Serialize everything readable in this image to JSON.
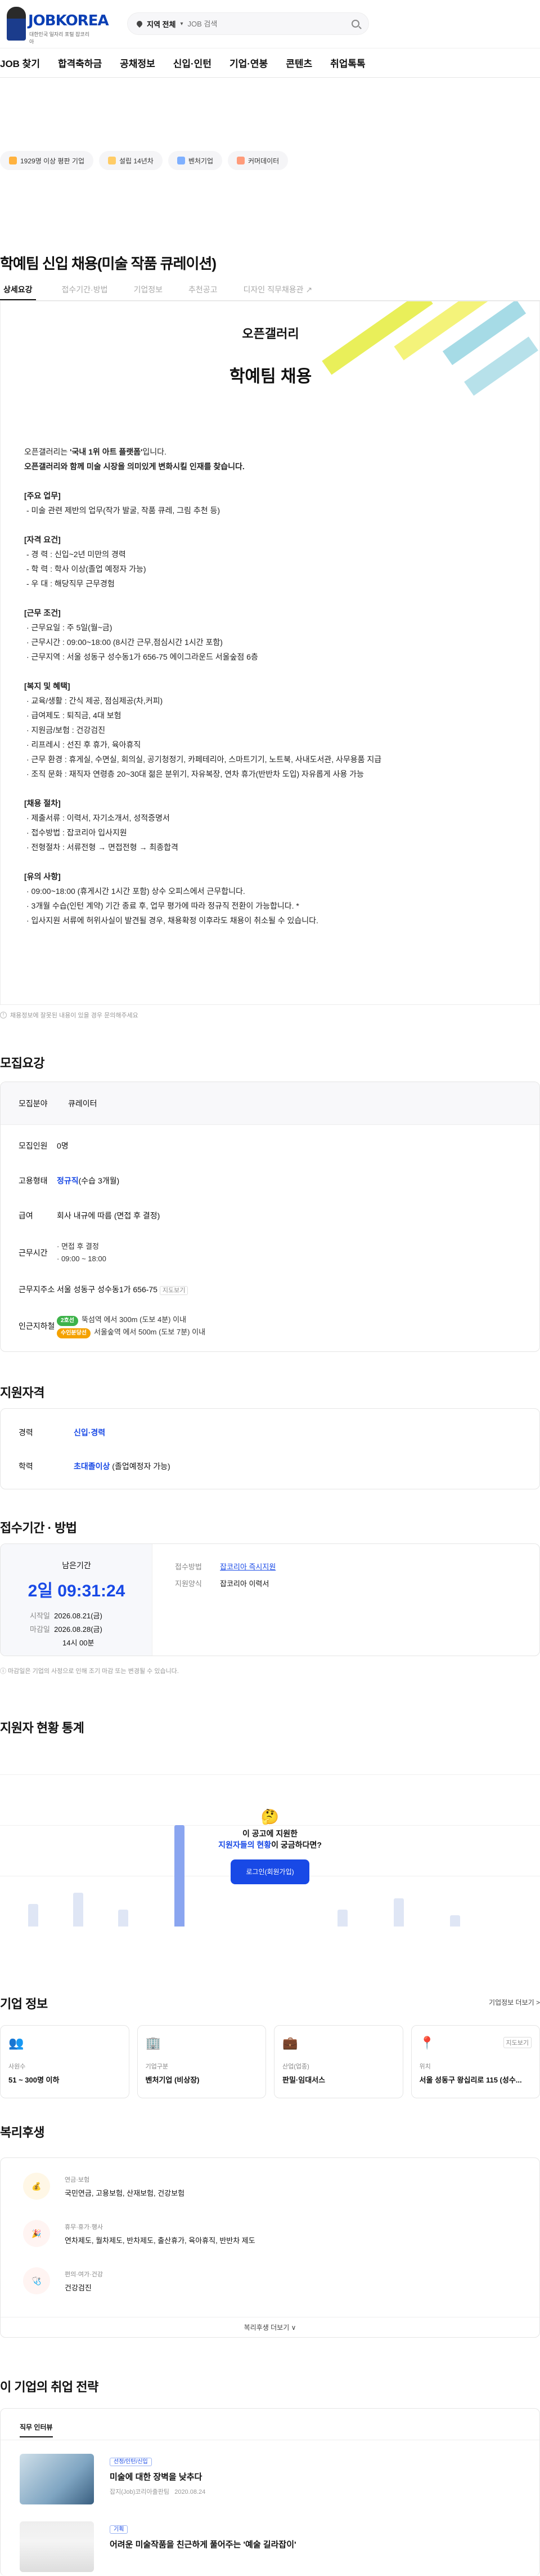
{
  "header": {
    "logo": "JOBKOREA",
    "logo_sub": "대한민국 일자리 포털 잡코리아",
    "region": "지역 전체",
    "search_placeholder": "JOB 검색"
  },
  "nav": [
    "JOB 찾기",
    "합격축하금",
    "공채정보",
    "신입·인턴",
    "기업·연봉",
    "콘텐츠",
    "취업톡톡"
  ],
  "chips": [
    "1929명 이상 평판 기업",
    "설립 14년차",
    "벤처기업",
    "커머데이터"
  ],
  "job": {
    "title": "학예팀 신입 채용(미술 작품 큐레이션)",
    "tabs": [
      "상세요강",
      "접수기간·방법",
      "기업정보",
      "추천공고",
      "디자인 직무채용관"
    ]
  },
  "poster": {
    "brand": "오픈갤러리",
    "heading": "학예팀 채용",
    "intro1_a": "오픈갤러리는 ",
    "intro1_b": "'국내 1위 아트 플랫폼'",
    "intro1_c": "입니다.",
    "intro2": "오픈갤러리와 함께 미술 시장을 의미있게 변화시킬 인재를 찾습니다.",
    "sections": [
      {
        "head": "[주요 업무]",
        "lines": [
          "- 미술 관련 제반의 업무(작가 발굴, 작품 큐레, 그림 추천 등)"
        ]
      },
      {
        "head": "[자격 요건]",
        "lines": [
          "- 경        력 : 신입~2년 미만의 경력",
          "- 학        력 : 학사 이상(졸업 예정자 가능)",
          "- 우        대 : 해당직무 근무경험"
        ]
      },
      {
        "head": "[근무 조건]",
        "lines": [
          "· 근무요일 : 주 5일(월~금)",
          "· 근무시간 : 09:00~18:00 (8시간 근무,점심시간 1시간 포함)",
          "· 근무지역 : 서울 성동구 성수동1가 656-75 에이그라운드 서울숲점 6층"
        ]
      },
      {
        "head": "[복지 및 혜택]",
        "lines": [
          "· 교육/생활 : 간식 제공, 점심제공(차,커피)",
          "· 급여제도 : 퇴직금, 4대 보험",
          "· 지원금/보험 : 건강검진",
          "· 리프레시 : 선진 후 휴가, 육아휴직",
          "· 근무 환경 : 휴게실, 수면실, 회의실, 공기청정기, 카페테리아, 스마트기기, 노트북, 사내도서관, 사무용품 지급",
          "· 조직 문화 : 재직자 연령층 20~30대 젊은 분위기, 자유복장, 연차 휴가(반반차 도입) 자유롭게 사용 가능"
        ]
      },
      {
        "head": "[채용 절차]",
        "lines": [
          "· 제출서류 : 이력서, 자기소개서, 성적증명서",
          "· 접수방법 : 잡코리아 입사지원",
          "· 전형절차 : 서류전형 → 면접전형 → 최종합격"
        ]
      },
      {
        "head": "[유의 사항]",
        "lines": [
          "· 09:00~18:00 (휴게시간 1시간 포함) 상수 오피스에서 근무합니다.",
          "· 3개월 수습(인턴 계약) 기간 종료 후, 업무 평가에 따라 정규직 전환이 가능합니다. *",
          "· 입사지원 서류에 허위사실이 발견될 경우, 채용확정 이후라도 채용이 취소될 수 있습니다."
        ]
      }
    ]
  },
  "notice_detail": "채용정보에 잘못된 내용이 있을 경우 문의해주세요",
  "summary": {
    "heading": "모집요강",
    "field_key": "모집분야",
    "field_val": "큐레이터",
    "count_key": "모집인원",
    "count_val": "0명",
    "type_key": "고용형태",
    "type_val": "정규직",
    "type_note": "(수습 3개월)",
    "pay_key": "급여",
    "pay_val": "회사 내규에 따름 (면접 후 결정)",
    "time_key": "근무시간",
    "time_a": "· 면접 후 결정",
    "time_b": "· 09:00 ~ 18:00",
    "addr_key": "근무지주소",
    "addr_val": "서울 성동구 성수동1가 656-75",
    "addr_link": "지도보기",
    "sub_key": "인근지하철",
    "sub1_tag": "2호선",
    "sub1": "뚝섬역 에서 300m (도보 4분) 이내",
    "sub2_tag": "수인분당선",
    "sub2": "서울숲역 에서 500m (도보 7분) 이내"
  },
  "qual": {
    "heading": "지원자격",
    "exp_key": "경력",
    "exp_val": "신입·경력",
    "edu_key": "학력",
    "edu_val": "초대졸이상",
    "edu_note": "(졸업예정자 가능)"
  },
  "apply": {
    "heading": "접수기간 · 방법",
    "left_label": "남은기간",
    "remain": "2일 09:31:24",
    "start_key": "시작일",
    "start_val": "2026.08.21(금)",
    "end_key": "마감일",
    "end_val": "2026.08.28(금)",
    "end_time": "14시 00분",
    "method_key": "접수방법",
    "method_val": "잡코리아 즉시지원",
    "form_key": "지원양식",
    "form_val": "잡코리아 이력서",
    "note": "마감일은 기업의 사정으로 인해 조기 마감 또는 변경될 수 있습니다."
  },
  "stats": {
    "heading": "지원자 현황 통계",
    "q1": "이 공고에 지원한",
    "q2a": "지원자들의 현황",
    "q2b": "이 궁금하다면?",
    "btn": "로그인(회원가입)"
  },
  "company": {
    "heading": "기업 정보",
    "more": "기업정보 더보기 >",
    "cards": [
      {
        "label": "사원수",
        "value": "51 ~ 300명 이하",
        "icon": "people-icon"
      },
      {
        "label": "기업구분",
        "value": "벤처기업 (비상장)",
        "icon": "building-icon"
      },
      {
        "label": "산업(업종)",
        "value": "판밀·임대서스",
        "icon": "briefcase-icon"
      },
      {
        "label": "위치",
        "value": "서울 성동구 왕십리로 115 (성수...",
        "icon": "location-icon",
        "link": "지도보기"
      }
    ]
  },
  "welfare": {
    "heading": "복리후생",
    "items": [
      {
        "title": "연금·보험",
        "desc": "국민연금, 고용보험, 산재보험, 건강보험"
      },
      {
        "title": "휴무·휴가·행사",
        "desc": "연차제도, 월차제도, 반차제도, 출산휴가, 육아휴직, 반반차 제도"
      },
      {
        "title": "편의·여가·건강",
        "desc": "건강검진"
      }
    ],
    "more": "복리후생 더보기 ∨"
  },
  "strategy": {
    "heading": "이 기업의 취업 전략",
    "tab": "직무 인터뷰",
    "articles": [
      {
        "tag": "선정/인턴/신입",
        "title": "미술에 대한 장벽을 낮추다",
        "meta": "잡지(Job)코리아출판팀",
        "date": "2020.08.24"
      },
      {
        "tag": "기획",
        "title": "어려운 미술작품을 친근하게 풀어주는 '예술 길라잡이'",
        "meta": "",
        "date": ""
      }
    ]
  }
}
